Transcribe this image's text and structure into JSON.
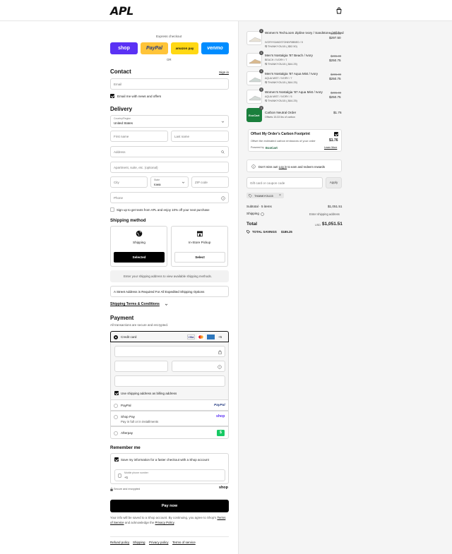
{
  "header": {
    "logo": "APL",
    "cart_icon": "bag-icon"
  },
  "express": {
    "title": "Express checkout",
    "shop": "shop",
    "paypal": "PayPal",
    "amazon": "amazon pay",
    "venmo": "venmo",
    "or": "OR"
  },
  "contact": {
    "title": "Contact",
    "signin": "Sign in",
    "email_placeholder": "Email",
    "news_label": "Email me with news and offers",
    "news_checked": true
  },
  "delivery": {
    "title": "Delivery",
    "country_label": "Country/Region",
    "country": "United States",
    "first_name": "First name",
    "last_name": "Last name",
    "address": "Address",
    "apartment": "Apartment, suite, etc. (optional)",
    "city": "City",
    "state_label": "State",
    "state": "Iowa",
    "zip": "ZIP code",
    "phone": "Phone",
    "sms_label": "Sign up to get texts from APL and enjoy 10% off your next purchase"
  },
  "shipping_method": {
    "title": "Shipping method",
    "shipping_label": "Shipping",
    "pickup_label": "In-Store Pickup",
    "selected_btn": "Selected",
    "select_btn": "Select",
    "note": "Enter your shipping address to view available shipping methods.",
    "street_note": "A Street Address is Required For All Expedited Shipping Options",
    "terms": "Shipping Terms & Conditions"
  },
  "payment": {
    "title": "Payment",
    "subtitle": "All transactions are secure and encrypted.",
    "credit_card": "Credit card",
    "more": "+5",
    "billing_label": "Use shipping address as billing address",
    "paypal": "PayPal",
    "paypal_logo": "PayPal",
    "shop_pay": "Shop Pay",
    "shop_pay_sub": "Pay in full or in installments",
    "shop_logo": "shop",
    "afterpay": "Afterpay"
  },
  "remember": {
    "title": "Remember me",
    "save_label": "Save my information for a faster checkout with a Shop account",
    "phone_label": "Mobile phone number",
    "phone_prefix": "+1",
    "secure": "Secure and encrypted",
    "shop": "shop"
  },
  "pay_now": "Pay now",
  "disclaimer": {
    "text": "Your info will be saved to a Shop account. By continuing, you agree to Shop's",
    "terms": "Terms of Service",
    "and": "and acknowledge the",
    "privacy": "Privacy Policy",
    "end": "."
  },
  "footer_links": [
    "Refund policy",
    "Shipping",
    "Privacy policy",
    "Terms of service"
  ],
  "cart": {
    "items": [
      {
        "qty": "1",
        "name": "Women's TechLoom Zipline Ivory / Sandstone / Ribbed",
        "variant": "IVORY/SANDSTONE/RIBBED / 5",
        "discount": "THANKYOU15 (-$52.50)",
        "old": "$350.00",
        "price": "$297.50"
      },
      {
        "qty": "1",
        "name": "Men's Nostalgia '87 Beach / Ivory",
        "variant": "BEACH / IVORY / 7",
        "discount": "THANKYOU15 (-$44.25)",
        "old": "$295.00",
        "price": "$250.75"
      },
      {
        "qty": "1",
        "name": "Men's Nostalgia '87 Aqua Mist / Ivory",
        "variant": "AQUA MIST / IVORY / 7",
        "discount": "THANKYOU15 (-$44.25)",
        "old": "$295.00",
        "price": "$250.75"
      },
      {
        "qty": "1",
        "name": "Women's Nostalgia '87 Aqua Mist / Ivory",
        "variant": "AQUA MIST / IVORY / 5",
        "discount": "THANKYOU15 (-$44.25)",
        "old": "$295.00",
        "price": "$250.75"
      },
      {
        "qty": "1",
        "name": "Carbon Neutral Order",
        "variant": "Offsets 15.33 lbs of carbon",
        "price": "$1.76",
        "img_label": "EcoCart"
      }
    ],
    "ecocart": {
      "title": "Offset My Order's Carbon Footprint",
      "price": "$1.76",
      "desc": "Offset the estimated carbon emissions of your order",
      "powered": "Powered by",
      "brand": "EcoCart",
      "learn": "Learn More"
    },
    "rewards": {
      "text": "Don't miss out!",
      "login": "Log in",
      "rest": "to earn and redeem rewards"
    },
    "coupon": {
      "placeholder": "Gift card or coupon code",
      "apply": "Apply",
      "tag": "THANKYOU15"
    },
    "subtotal_label": "Subtotal · 5 items",
    "subtotal": "$1,051.51",
    "shipping_label": "Shipping",
    "shipping_value": "Enter shipping address",
    "total_label": "Total",
    "currency": "USD",
    "total": "$1,051.51",
    "savings_label": "TOTAL SAVINGS",
    "savings": "$185.25"
  }
}
